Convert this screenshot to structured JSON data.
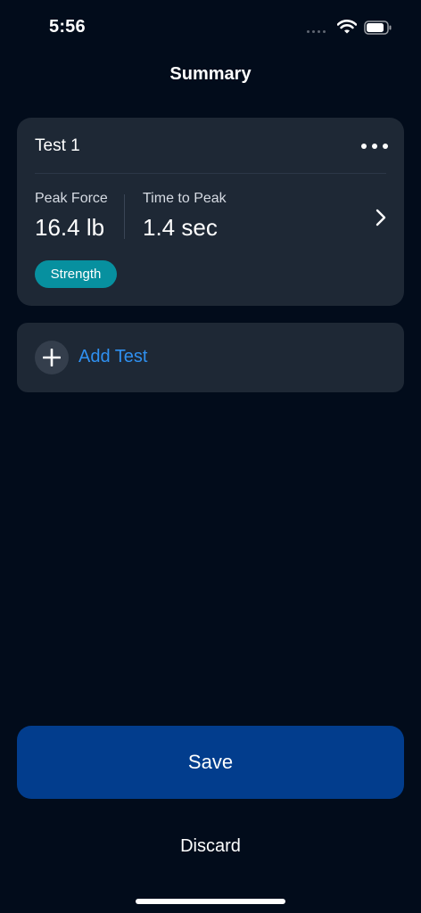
{
  "status_bar": {
    "time": "5:56"
  },
  "header": {
    "title": "Summary"
  },
  "test_card": {
    "title": "Test 1",
    "metrics": [
      {
        "label": "Peak Force",
        "value": "16.4 lb"
      },
      {
        "label": "Time to Peak",
        "value": "1.4 sec"
      }
    ],
    "badge": "Strength",
    "icons": {
      "more": "more-horizontal-icon",
      "open": "chevron-right-icon"
    }
  },
  "add_test": {
    "label": "Add Test",
    "icon": "plus-icon"
  },
  "actions": {
    "save_label": "Save",
    "discard_label": "Discard"
  },
  "colors": {
    "background": "#020c1b",
    "card": "#1e2835",
    "accent_blue": "#2f90f0",
    "save_button": "#023d8d",
    "badge_teal": "#07909f"
  }
}
